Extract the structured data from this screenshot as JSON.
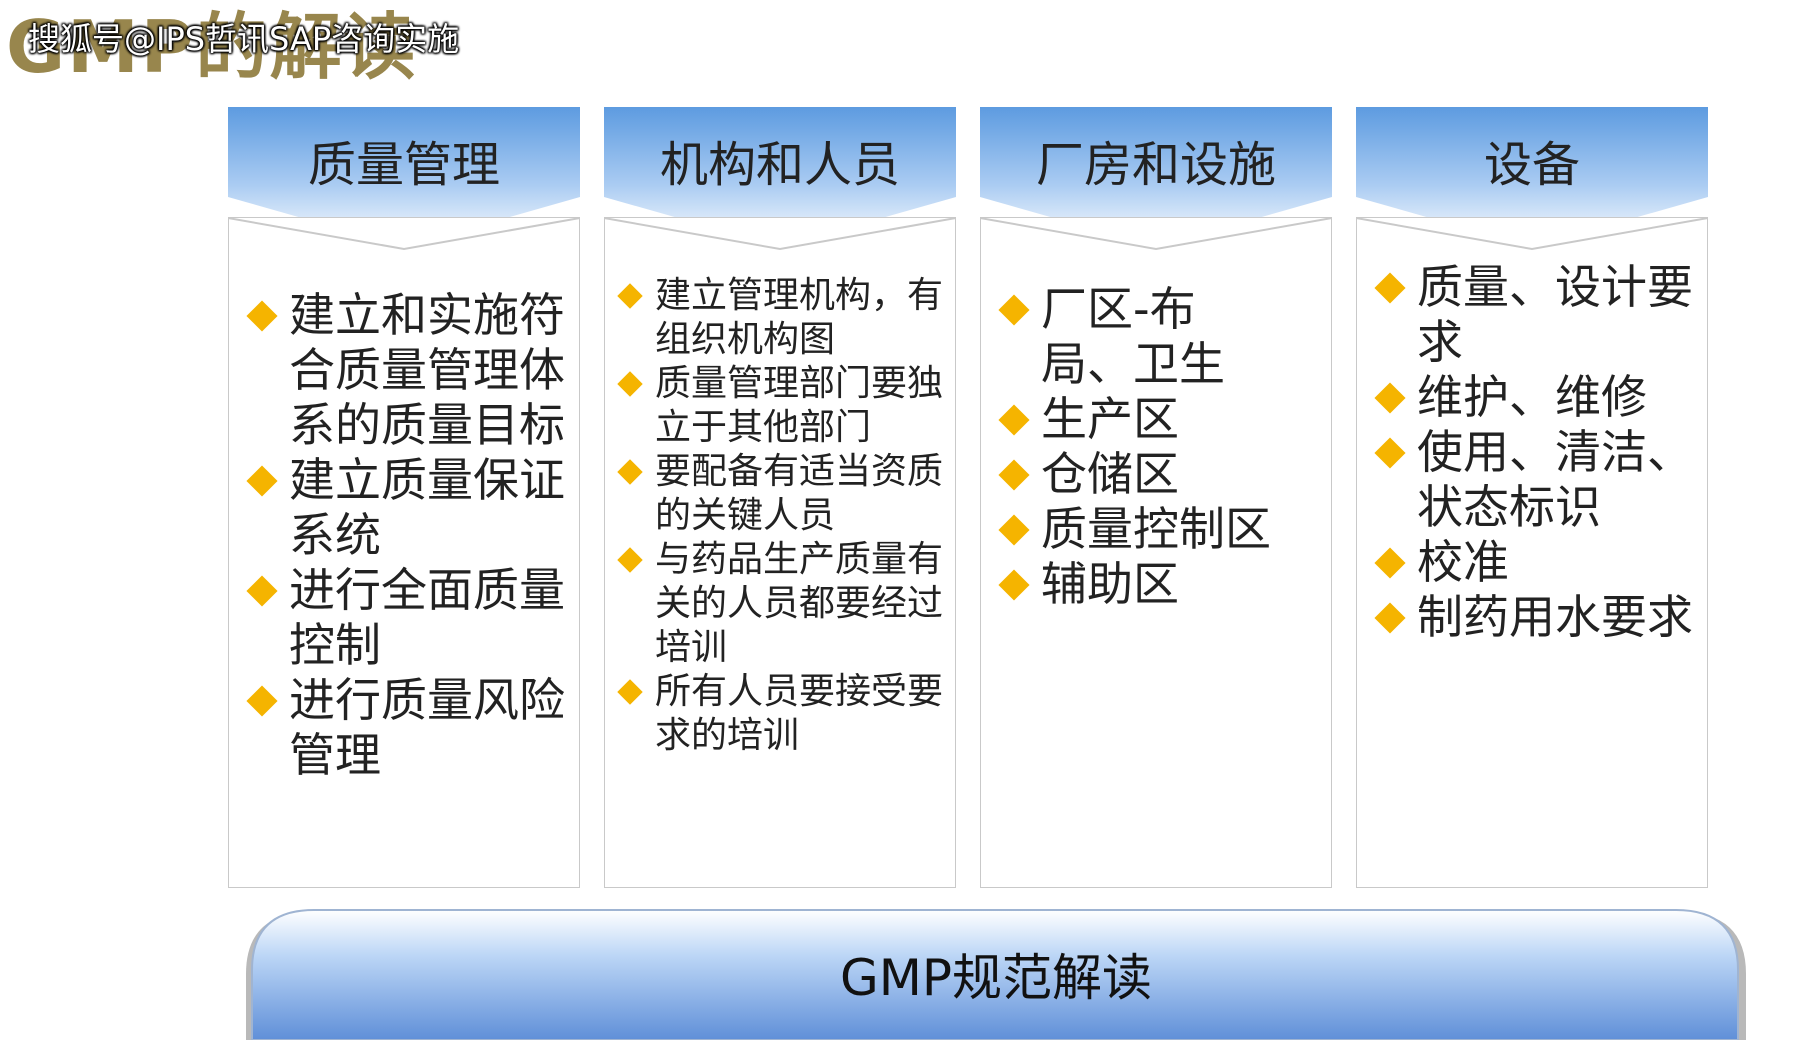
{
  "slide": {
    "title": "GMP的解读",
    "watermark": "搜狐号@IPS哲讯SAP咨询实施"
  },
  "colors": {
    "header_top": "#5d9be0",
    "header_bottom": "#ffffff",
    "bullet": "#f5b400",
    "banner_top": "#bcd6f6",
    "banner_bottom": "#5f8fd8"
  },
  "columns": [
    {
      "header": "质量管理",
      "items": [
        "建立和实施符合质量管理体系的质量目标",
        "建立质量保证系统",
        "进行全面质量控制",
        "进行质量风险管理"
      ]
    },
    {
      "header": "机构和人员",
      "items": [
        "建立管理机构，有组织机构图",
        "质量管理部门要独立于其他部门",
        "要配备有适当资质的关键人员",
        "与药品生产质量有关的人员都要经过培训",
        "所有人员要接受要求的培训"
      ]
    },
    {
      "header": "厂房和设施",
      "items": [
        "厂区-布局、卫生",
        "生产区",
        "仓储区",
        "质量控制区",
        "辅助区"
      ]
    },
    {
      "header": "设备",
      "items": [
        "质量、设计要求",
        "维护、维修",
        "使用、清洁、状态标识",
        "校准",
        "制药用水要求"
      ]
    }
  ],
  "banner": {
    "label": "GMP规范解读"
  }
}
